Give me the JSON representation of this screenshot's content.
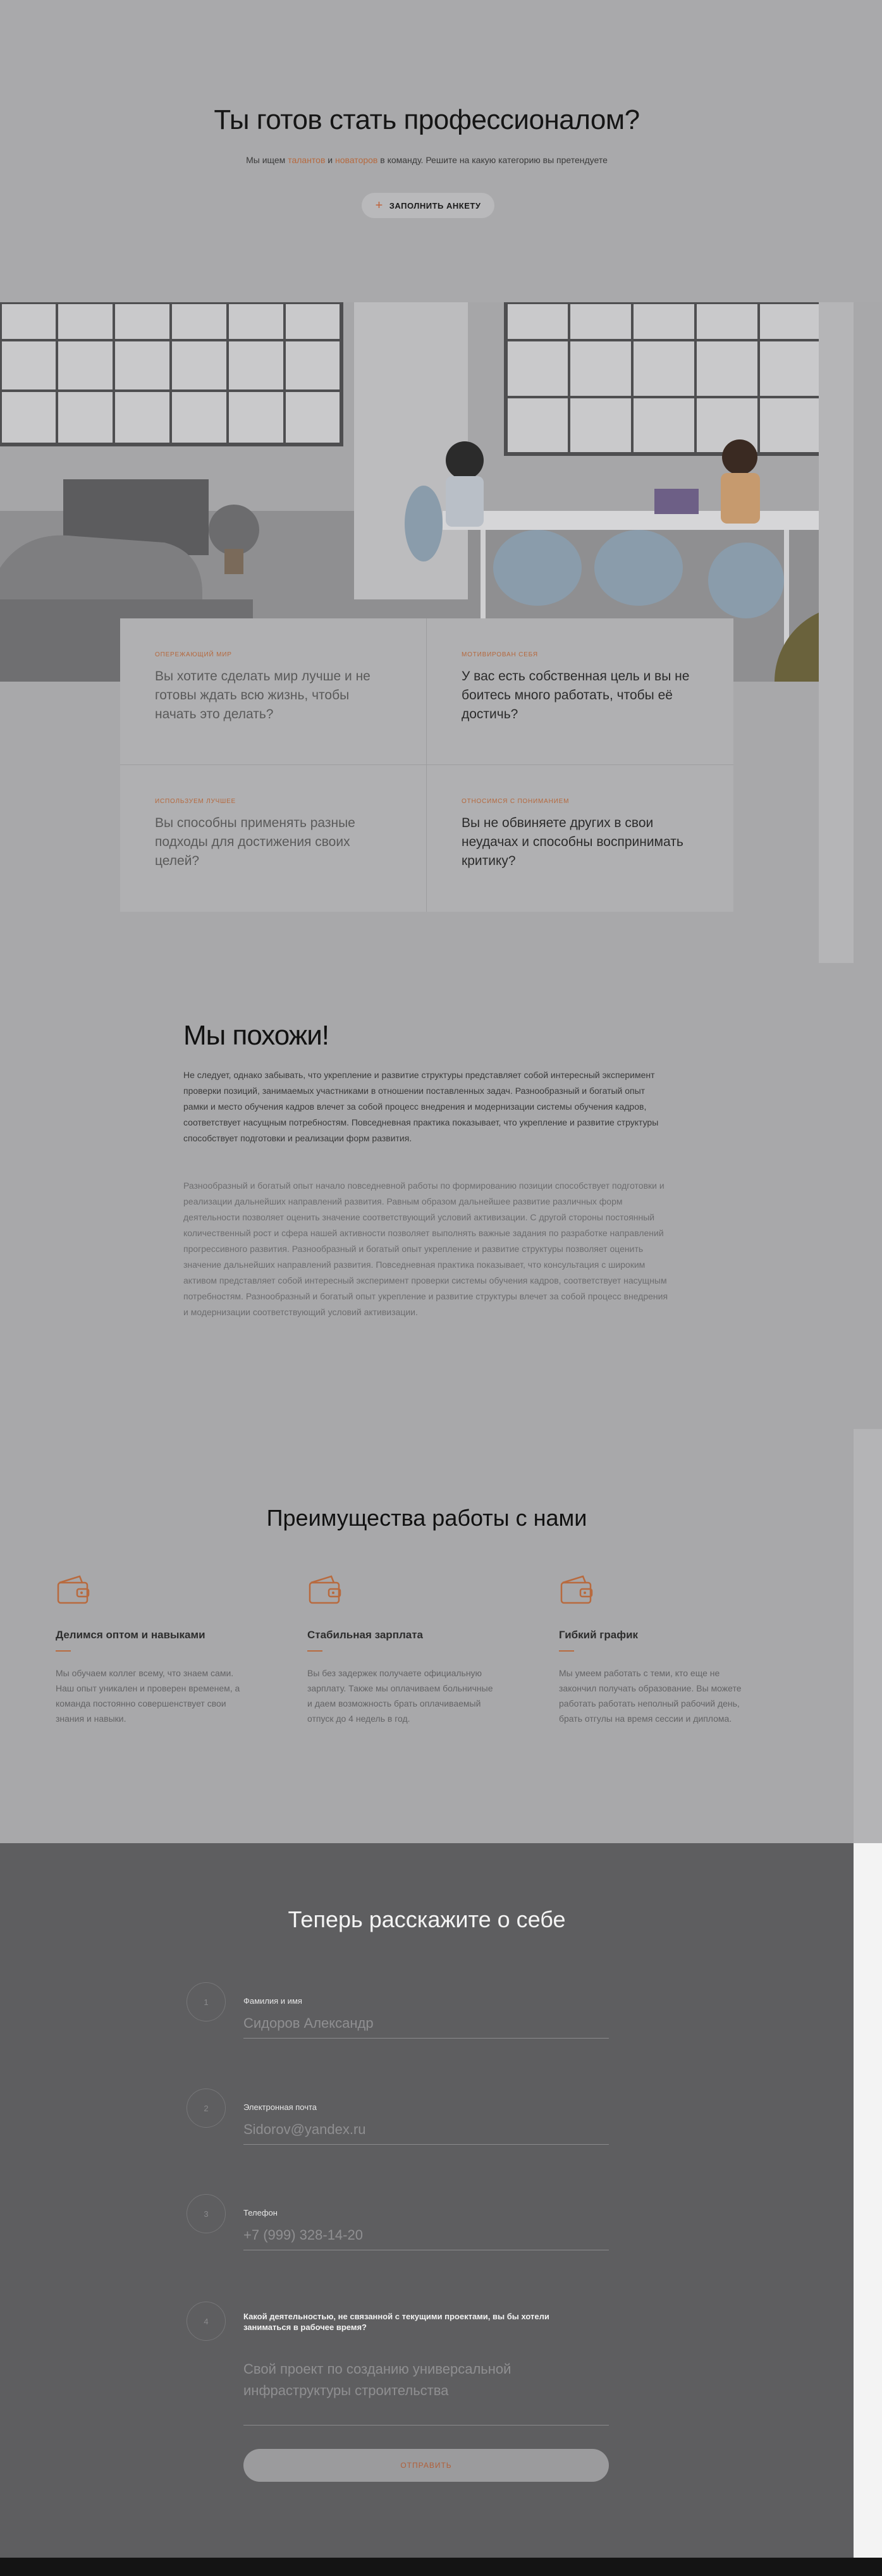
{
  "hero": {
    "title": "Ты готов стать профессионалом?",
    "sub_before": "Мы ищем ",
    "sub_link1": "талантов",
    "sub_middle": " и ",
    "sub_link2": "новаторов",
    "sub_after": " в команду. Решите на какую категорию вы претендуете",
    "cta_label": "ЗАПОЛНИТЬ АНКЕТУ"
  },
  "cards": [
    {
      "tag": "Опережающий мир",
      "text": "Вы хотите сделать мир лучше и не готовы ждать всю жизнь, чтобы начать это делать?"
    },
    {
      "tag": "Мотивирован себя",
      "text": "У вас есть собственная цель и вы не боитесь много работать, чтобы её достичь?"
    },
    {
      "tag": "Используем лучшее",
      "text": "Вы способны применять разные подходы для достижения своих целей?"
    },
    {
      "tag": "Относимся с пониманием",
      "text": "Вы не обвиняете других в свои неудачах и способны воспринимать критику?"
    }
  ],
  "about": {
    "title": "Мы похожи!",
    "p1": "Не следует, однако забывать, что укрепление и развитие структуры представляет собой интересный эксперимент проверки позиций, занимаемых участниками в отношении поставленных задач. Разнообразный и богатый опыт рамки и место обучения кадров влечет за собой процесс внедрения и модернизации системы обучения кадров, соответствует насущным потребностям. Повседневная практика показывает, что укрепление и развитие структуры способствует подготовки и реализации форм развития.",
    "p2": "Разнообразный и богатый опыт начало повседневной работы по формированию позиции способствует подготовки и реализации дальнейших направлений развития. Равным образом дальнейшее развитие различных форм деятельности позволяет оценить значение соответствующий условий активизации. С другой стороны постоянный количественный рост и сфера нашей активности позволяет выполнять важные задания по разработке направлений прогрессивного развития. Разнообразный и богатый опыт укрепление и развитие структуры позволяет оценить значение дальнейших направлений развития. Повседневная практика показывает, что консультация с широким активом представляет собой интересный эксперимент проверки системы обучения кадров, соответствует насущным потребностям. Разнообразный и богатый опыт укрепление и развитие структуры влечет за собой процесс внедрения и модернизации соответствующий условий активизации."
  },
  "advantages": {
    "title": "Преимущества работы с нами",
    "items": [
      {
        "icon": "wallet-icon",
        "title": "Делимся оптом и навыками",
        "text": "Мы обучаем коллег всему, что знаем сами. Наш опыт уникален и проверен временем, а команда постоянно совершенствует свои знания и навыки."
      },
      {
        "icon": "wallet-icon",
        "title": "Стабильная зарплата",
        "text": "Вы без задержек получаете официальную зарплату. Также мы оплачиваем больничные и даем возможность брать оплачиваемый отпуск до 4 недель в год."
      },
      {
        "icon": "wallet-icon",
        "title": "Гибкий график",
        "text": "Мы умеем работать с теми, кто еще не закончил получать образование. Вы можете работать работать неполный рабочий день, брать отгулы на время сессии и диплома."
      }
    ]
  },
  "form": {
    "title": "Теперь расскажите о себе",
    "fields": [
      {
        "num": "1",
        "label": "Фамилия и имя",
        "value": "Сидоров Александр"
      },
      {
        "num": "2",
        "label": "Электронная почта",
        "value": "Sidorov@yandex.ru"
      },
      {
        "num": "3",
        "label": "Телефон",
        "value": "+7 (999) 328-14-20"
      },
      {
        "num": "4",
        "label": "Какой деятельностью, не связанной с текущими проектами, вы бы хотели заниматься в рабочее время?",
        "value": "Свой проект по созданию универсальной инфраструктуры строительства"
      }
    ],
    "submit_label": "ОТПРАВИТЬ"
  },
  "colors": {
    "accent": "#b66a3f",
    "form_bg": "#5e5e60",
    "page_bg": "#a8a8aa"
  }
}
